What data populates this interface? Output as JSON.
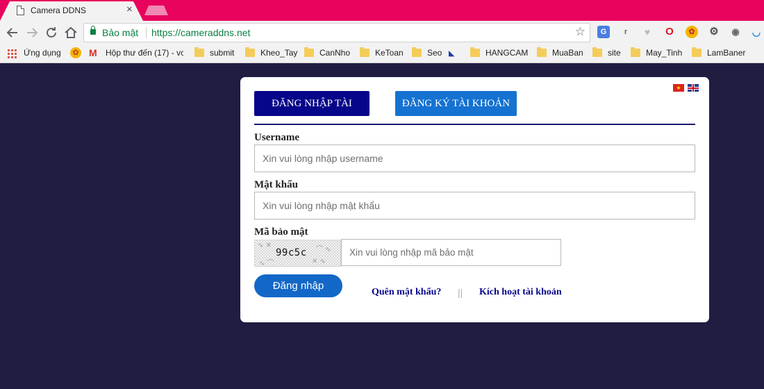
{
  "browser": {
    "tab_title": "Camera DDNS",
    "tab_close": "×",
    "secure_label": "Bảo mật",
    "url": "https://cameraddns.net",
    "bookmarks": [
      {
        "label": "Ứng dụng",
        "icon": "apps-grid-icon"
      },
      {
        "label": "",
        "icon": "extension-icon"
      },
      {
        "label": "Hộp thư đến (17) - vc",
        "icon": "gmail-icon"
      },
      {
        "label": "submit",
        "icon": "folder-icon"
      },
      {
        "label": "Kheo_Tay",
        "icon": "folder-icon"
      },
      {
        "label": "CanNho",
        "icon": "folder-icon"
      },
      {
        "label": "KeToan",
        "icon": "folder-icon"
      },
      {
        "label": "Seo",
        "icon": "folder-icon"
      },
      {
        "label": "",
        "icon": "site-favicon-icon"
      },
      {
        "label": "HANGCAM",
        "icon": "folder-icon"
      },
      {
        "label": "MuaBan",
        "icon": "folder-icon"
      },
      {
        "label": "site",
        "icon": "folder-icon"
      },
      {
        "label": "May_Tinh",
        "icon": "folder-icon"
      },
      {
        "label": "LamBaner",
        "icon": "folder-icon"
      }
    ],
    "extensions": [
      "translate-icon",
      "r-icon",
      "heart-icon",
      "opera-icon",
      "extension-icon",
      "gear-icon",
      "eye-icon",
      "wave-icon"
    ],
    "colors": {
      "tab_strip": "#e8035c",
      "secure": "#0b8043"
    }
  },
  "login": {
    "tabs": {
      "login": "ĐĂNG NHẬP TÀI KHOẢN",
      "register": "ĐĂNG KÝ TÀI KHOẢN"
    },
    "username": {
      "label": "Username",
      "placeholder": "Xin vui lòng nhập username"
    },
    "password": {
      "label": "Mật khẩu",
      "placeholder": "Xin vui lòng nhập mật khẩu"
    },
    "captcha": {
      "label": "Mã bảo mật",
      "code": "99c5c",
      "placeholder": "Xin vui lòng nhập mã bảo mật"
    },
    "submit_label": "Đăng nhập",
    "forgot_label": "Quên mật khẩu?",
    "separator": "||",
    "activate_label": "Kích hoạt tài khoản",
    "languages": [
      "vietnamese-flag-icon",
      "english-flag-icon"
    ],
    "colors": {
      "page_bg": "#211d41",
      "tab_active": "#06068a",
      "tab_inactive": "#1572d1",
      "button": "#1368c7"
    }
  }
}
